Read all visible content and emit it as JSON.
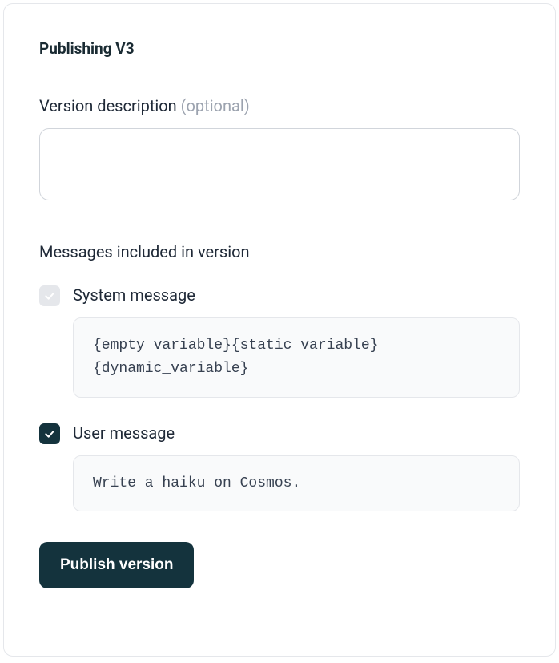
{
  "title": "Publishing V3",
  "description": {
    "label": "Version description",
    "optional": "(optional)",
    "value": ""
  },
  "messagesHeading": "Messages included in version",
  "messages": {
    "system": {
      "label": "System message",
      "content": "{empty_variable}{static_variable}{dynamic_variable}",
      "checked": true,
      "disabled": true
    },
    "user": {
      "label": "User message",
      "content": "Write a haiku on Cosmos.",
      "checked": true,
      "disabled": false
    }
  },
  "publishButton": "Publish version"
}
